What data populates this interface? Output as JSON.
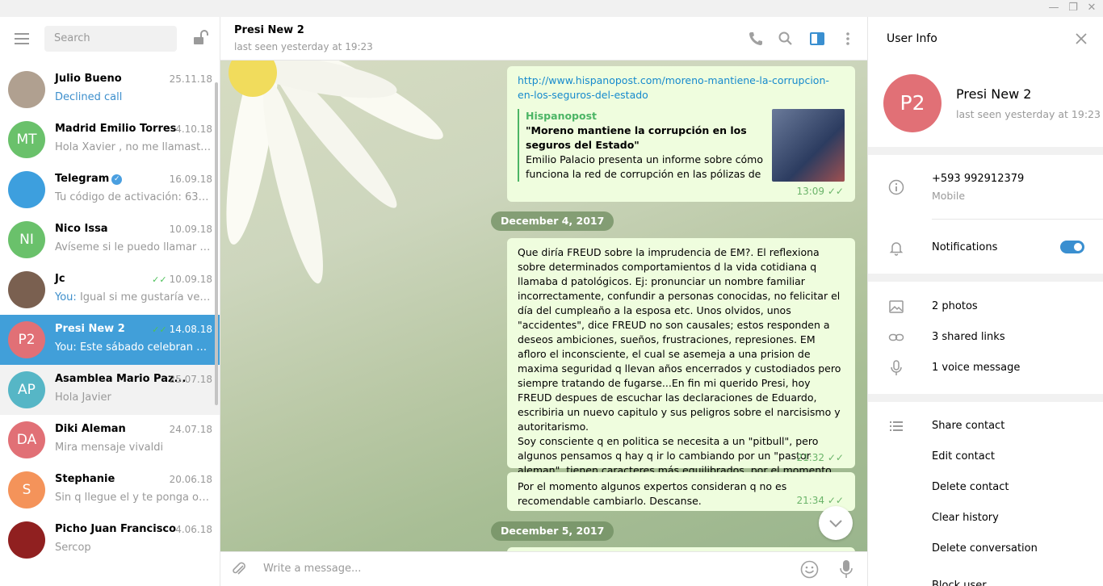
{
  "window": {
    "minimize": "—",
    "maximize": "❐",
    "close": "✕"
  },
  "sidebar": {
    "search_placeholder": "Search",
    "chats": [
      {
        "initials": "AP",
        "color": "#56b6c6",
        "name": "",
        "date": "",
        "preview": "👌👌",
        "partial": true
      },
      {
        "initials": "",
        "color": "#b0a090",
        "name": "Julio Bueno",
        "date": "25.11.18",
        "preview": "Declined call",
        "preview_style": "blue"
      },
      {
        "initials": "MT",
        "color": "#6ac16b",
        "name": "Madrid Emilio Torres",
        "date": "4.10.18",
        "preview": "Hola Xavier , no me llamaste y ..."
      },
      {
        "initials": "",
        "color": "#3d9fde",
        "name": "Telegram",
        "verified": true,
        "date": "16.09.18",
        "preview": "Tu código de activación: 63664 ..."
      },
      {
        "initials": "NI",
        "color": "#6ac16b",
        "name": "Nico Issa",
        "date": "10.09.18",
        "preview": "Avíseme si le puedo llamar por ..."
      },
      {
        "initials": "",
        "color": "#7a6050",
        "name": "Jc",
        "date": "10.09.18",
        "ticks": true,
        "sender": "You:",
        "preview": "Igual si me gustaría verlo s..."
      },
      {
        "initials": "P2",
        "color": "#e17076",
        "name": "Presi New 2",
        "date": "14.08.18",
        "ticks": true,
        "sender": "You:",
        "preview": "Este sábado celebran 4 a...",
        "active": true
      },
      {
        "initials": "AP",
        "color": "#56b6c6",
        "name": "Asamblea Mario Paz...",
        "date": "25.07.18",
        "preview": "Hola Javier",
        "hover": true
      },
      {
        "initials": "DA",
        "color": "#e17076",
        "name": "Diki Aleman",
        "date": "24.07.18",
        "preview": "Mira mensaje vivaldi"
      },
      {
        "initials": "S",
        "color": "#f4935a",
        "name": "Stephanie",
        "date": "20.06.18",
        "preview": "Sin q llegue el y te ponga obstá..."
      },
      {
        "initials": "",
        "color": "#902020",
        "name": "Picho Juan Francisco",
        "date": "4.06.18",
        "preview": "Sercop"
      }
    ]
  },
  "chat": {
    "peer_name": "Presi New 2",
    "peer_status": "last seen yesterday at 19:23",
    "msg1": {
      "link": "http://www.hispanopost.com/moreno-mantiene-la-corrupcion-en-los-seguros-del-estado",
      "site": "Hispanopost",
      "title": "\"Moreno mantiene la corrupción en los seguros del Estado\"",
      "desc": "Emilio Palacio presenta un informe sobre cómo funciona la red de corrupción en las pólizas de s...",
      "time": "13:09"
    },
    "date1": "December 4, 2017",
    "msg2": {
      "text": "Que diría FREUD sobre la imprudencia de EM?. El reflexiona sobre determinados comportamientos d la vida cotidiana q llamaba d patológicos. Ej: pronunciar un nombre familiar incorrectamente, confundir a personas conocidas, no felicitar el día del cumpleaño a la esposa etc. Unos olvidos, unos \"accidentes\", dice FREUD  no son causales; estos responden a deseos ambiciones, sueños, frustraciones, represiones. EM afloro el inconsciente,  el cual se asemeja a una prision de maxima seguridad q llevan años encerrados y custodiados pero siempre tratando de fugarse...En fin mi querido Presi, hoy FREUD despues de escuchar las declaraciones de Eduardo, escribiria un nuevo capitulo y sus peligros sobre el narcisismo y autoritarismo.",
      "text2": "Soy consciente q en politica se necesita a un \"pitbull\", pero algunos pensamos q hay q ir lo cambiando por un \"pastor aleman\", tienen caracteres más equilibrados. por el momento no",
      "time": "21:32"
    },
    "msg3": {
      "text": "Por el momento algunos expertos consideran q no es recomendable cambiarlo. Descanse.",
      "time": "21:34"
    },
    "date2": "December 5, 2017",
    "compose_placeholder": "Write a message..."
  },
  "user_info": {
    "title": "User Info",
    "initials": "P2",
    "name": "Presi New 2",
    "status": "last seen yesterday at 19:23",
    "phone": "+593 992912379",
    "phone_label": "Mobile",
    "notifications": "Notifications",
    "notifications_on": true,
    "photos": "2 photos",
    "links": "3 shared links",
    "voice": "1 voice message",
    "actions": [
      "Share contact",
      "Edit contact",
      "Delete contact",
      "Clear history",
      "Delete conversation",
      "Block user"
    ]
  }
}
